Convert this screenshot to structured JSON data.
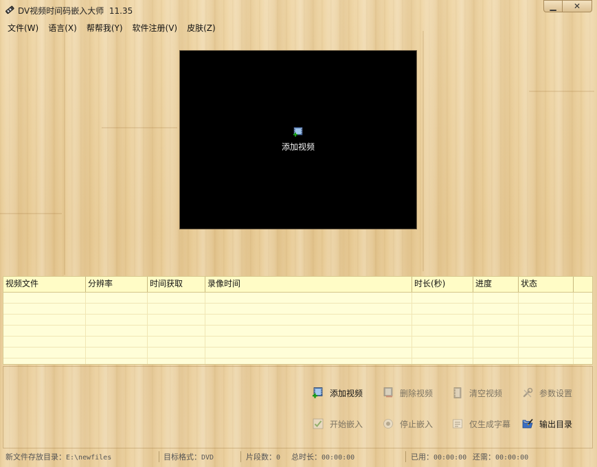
{
  "window": {
    "title": "DV视频时间码嵌入大师  11.35",
    "minimize_symbol": "▁",
    "close_symbol": "✕"
  },
  "menu": [
    "文件(W)",
    "语言(X)",
    "帮帮我(Y)",
    "软件注册(V)",
    "皮肤(Z)"
  ],
  "preview": {
    "add_video_label": "添加视频",
    "icon": "film-add-icon"
  },
  "table": {
    "columns": [
      "视频文件",
      "分辨率",
      "时间获取",
      "录像时间",
      "时长(秒)",
      "进度",
      "状态",
      ""
    ],
    "rows": []
  },
  "actions": {
    "add_video": {
      "label": "添加视频",
      "icon": "film-add-icon",
      "enabled": true
    },
    "delete_video": {
      "label": "删除视频",
      "icon": "film-delete-icon",
      "enabled": false
    },
    "clear_video": {
      "label": "清空视频",
      "icon": "film-clear-icon",
      "enabled": false
    },
    "settings": {
      "label": "参数设置",
      "icon": "wrench-icon",
      "enabled": false
    },
    "start_embed": {
      "label": "开始嵌入",
      "icon": "checkmark-icon",
      "enabled": false
    },
    "stop_embed": {
      "label": "停止嵌入",
      "icon": "stop-icon",
      "enabled": false
    },
    "subtitle_only": {
      "label": "仅生成字幕",
      "icon": "subtitle-icon",
      "enabled": false
    },
    "output_dir": {
      "label": "输出目录",
      "icon": "folder-pen-icon",
      "enabled": true
    }
  },
  "status": {
    "save_dir_label": "新文件存放目录：",
    "save_dir_value": "E:\\newfiles",
    "format_label": "目标格式：",
    "format_value": "DVD",
    "segments_label": "片段数：",
    "segments_value": "0",
    "total_label": "总时长：",
    "total_value": "00:00:00",
    "used_label": "已用：",
    "used_value": "00:00:00",
    "remain_label": "还需：",
    "remain_value": "00:00:00"
  },
  "colors": {
    "wood_light": "#efd6a6",
    "wood_mid": "#e8cb95",
    "table_bg": "#fffed8",
    "table_header_bg": "#fffcc6",
    "preview_bg": "#000000"
  }
}
